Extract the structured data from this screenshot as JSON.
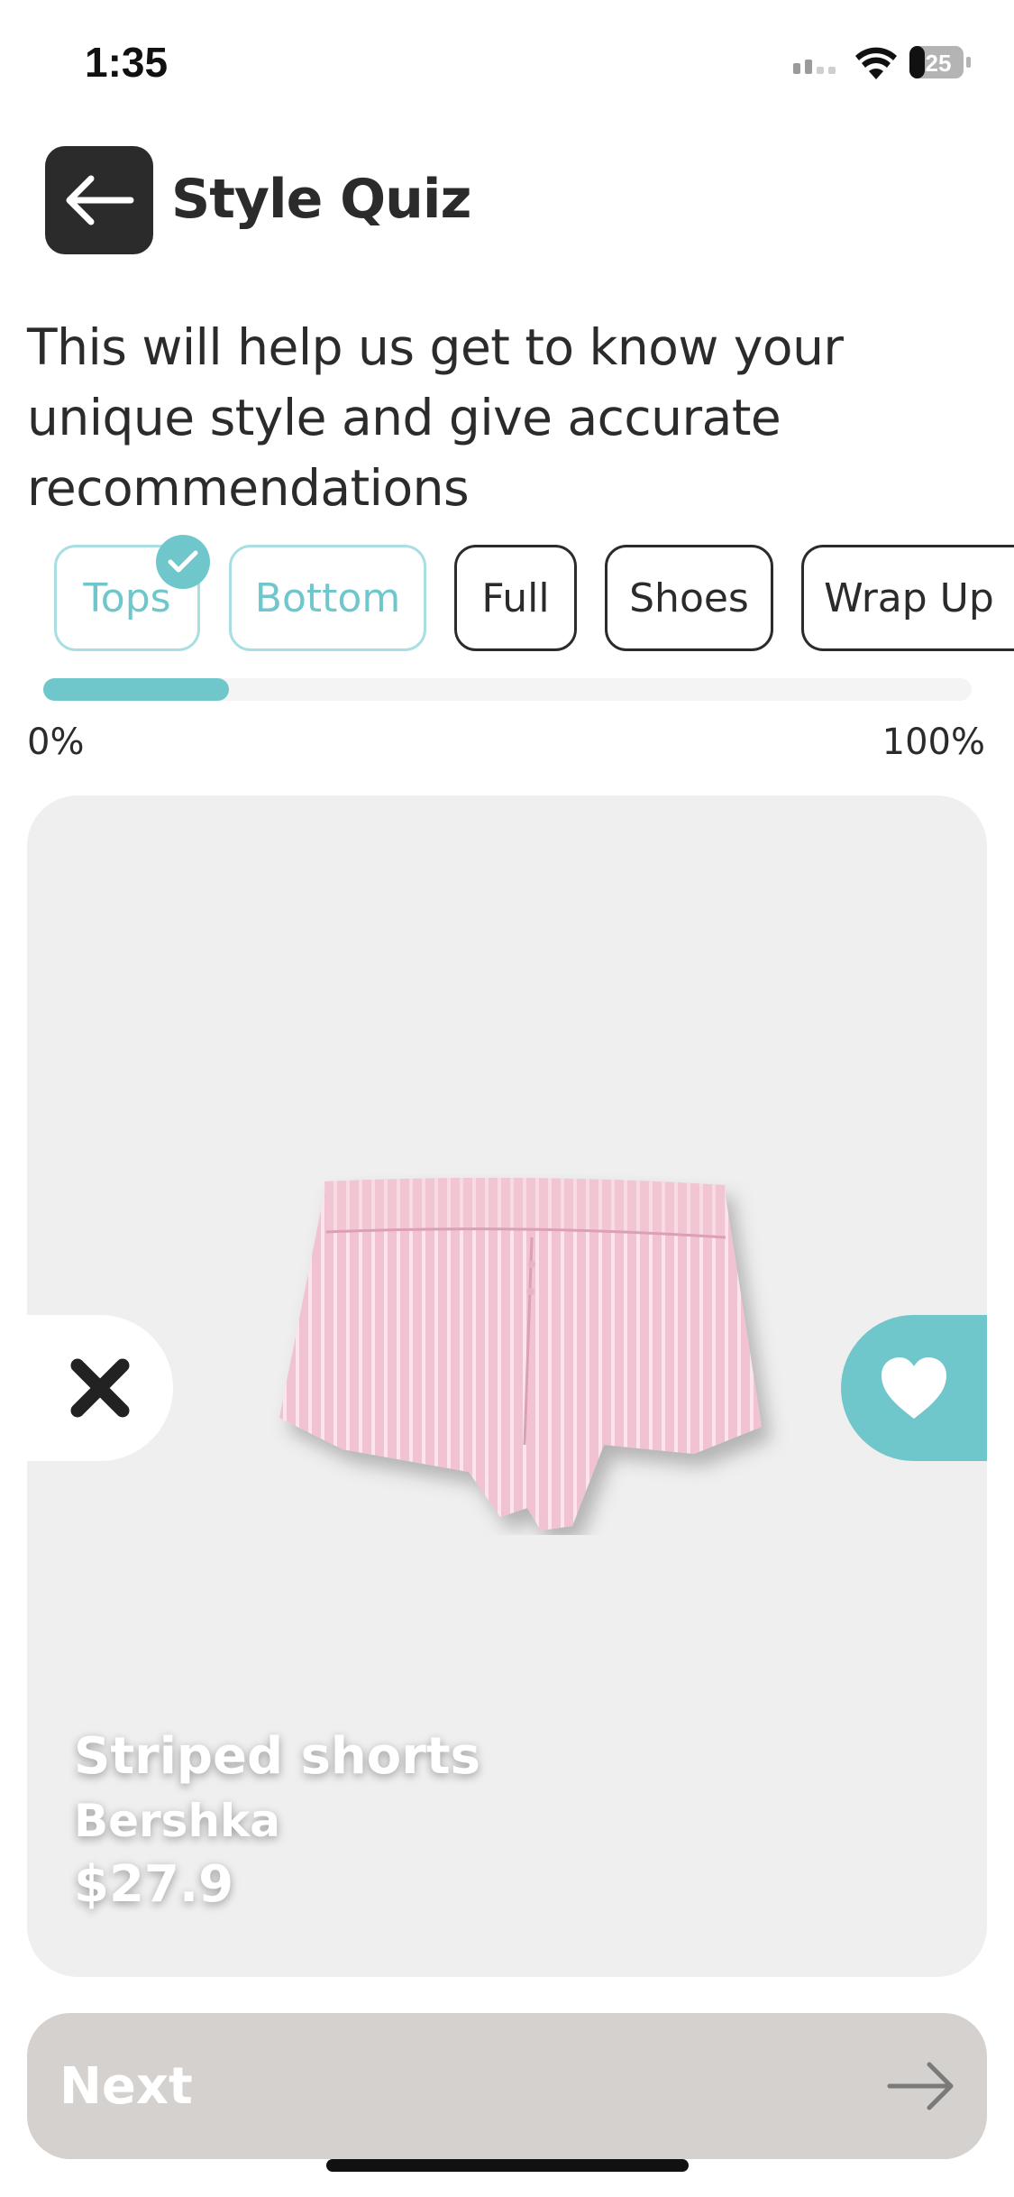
{
  "status_bar": {
    "time": "1:35",
    "battery": "25"
  },
  "header": {
    "title": "Style Quiz"
  },
  "intro": "This will help us get to know your unique style and give accurate recommendations",
  "tabs": [
    {
      "label": "Tops",
      "completed": true
    },
    {
      "label": "Bottom",
      "completed": false,
      "active": true
    },
    {
      "label": "Full",
      "completed": false
    },
    {
      "label": "Shoes",
      "completed": false
    },
    {
      "label": "Wrap Up",
      "completed": false
    }
  ],
  "progress": {
    "fraction": 0.2,
    "start_label": "0%",
    "end_label": "100%"
  },
  "product": {
    "name": "Striped shorts",
    "brand": "Bershka",
    "price": "$27.9"
  },
  "actions": {
    "next_label": "Next"
  },
  "colors": {
    "accent": "#6fc7cc",
    "dark": "#2b2b2b",
    "card_bg": "#efefef",
    "next_bg": "#d4d1ce"
  }
}
